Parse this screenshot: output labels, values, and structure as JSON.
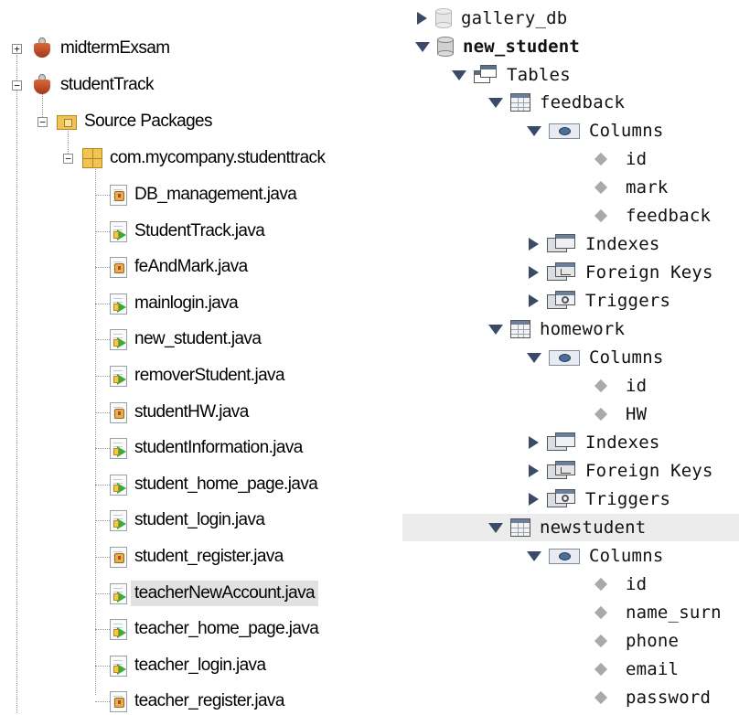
{
  "left_tree": {
    "projects": [
      {
        "label": "midtermExsam",
        "expanded": false,
        "toggle": "+"
      },
      {
        "label": "studentTrack",
        "expanded": true,
        "toggle": "−"
      }
    ],
    "source_packages": {
      "label": "Source Packages",
      "toggle": "−"
    },
    "package": {
      "label": "com.mycompany.studenttrack",
      "toggle": "−"
    },
    "files": [
      {
        "label": "DB_management.java",
        "icon": "java-form-file-icon"
      },
      {
        "label": "StudentTrack.java",
        "icon": "java-class-file-icon"
      },
      {
        "label": "feAndMark.java",
        "icon": "java-form-file-icon"
      },
      {
        "label": "mainlogin.java",
        "icon": "java-class-file-icon"
      },
      {
        "label": "new_student.java",
        "icon": "java-class-file-icon"
      },
      {
        "label": "removerStudent.java",
        "icon": "java-class-file-icon"
      },
      {
        "label": "studentHW.java",
        "icon": "java-form-file-icon"
      },
      {
        "label": "studentInformation.java",
        "icon": "java-class-file-icon"
      },
      {
        "label": "student_home_page.java",
        "icon": "java-class-file-icon"
      },
      {
        "label": "student_login.java",
        "icon": "java-class-file-icon"
      },
      {
        "label": "student_register.java",
        "icon": "java-form-file-icon"
      },
      {
        "label": "teacherNewAccount.java",
        "icon": "java-class-file-icon",
        "selected": true
      },
      {
        "label": "teacher_home_page.java",
        "icon": "java-class-file-icon"
      },
      {
        "label": "teacher_login.java",
        "icon": "java-class-file-icon"
      },
      {
        "label": "teacher_register.java",
        "icon": "java-form-file-icon"
      }
    ]
  },
  "right_tree": {
    "db_other": "gallery_db",
    "db_main": "new_student",
    "tables_label": "Tables",
    "feedback": {
      "name": "feedback",
      "columns_label": "Columns",
      "columns": [
        "id",
        "mark",
        "feedback"
      ],
      "indexes": "Indexes",
      "foreign_keys": "Foreign Keys",
      "triggers": "Triggers"
    },
    "homework": {
      "name": "homework",
      "columns_label": "Columns",
      "columns": [
        "id",
        "HW"
      ],
      "indexes": "Indexes",
      "foreign_keys": "Foreign Keys",
      "triggers": "Triggers"
    },
    "newstudent": {
      "name": "newstudent",
      "columns_label": "Columns",
      "columns": [
        "id",
        "name_surn",
        "phone",
        "email",
        "password"
      ]
    }
  }
}
